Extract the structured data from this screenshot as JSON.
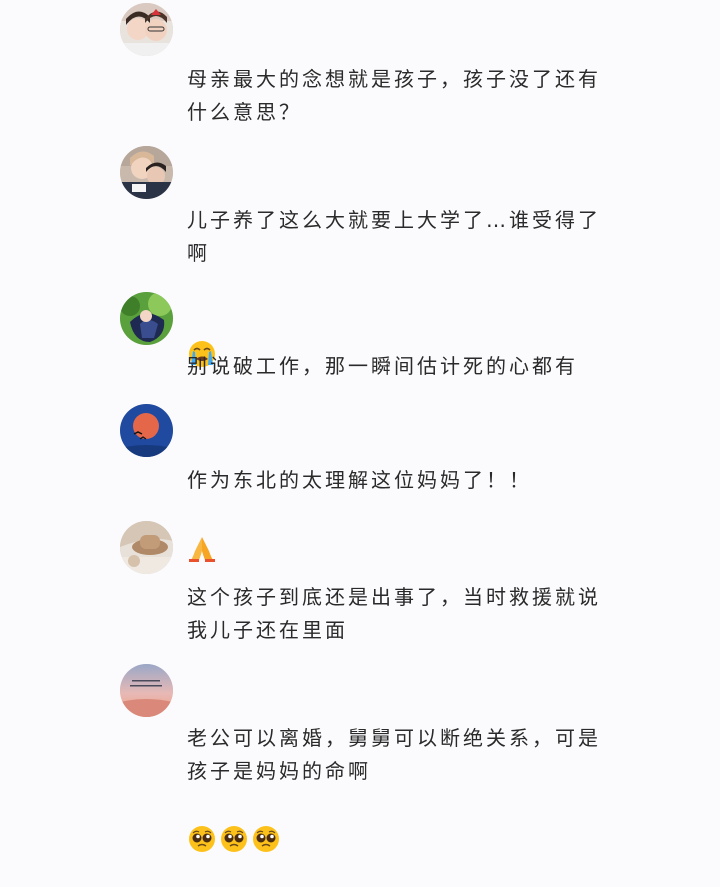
{
  "comments": [
    {
      "text": "母亲最大的念想就是孩子，孩子没了还有\n什么意思？",
      "avatar_icon": "avatar-two-girls-photo",
      "emojis": []
    },
    {
      "text": "儿子养了这么大就要上大学了…谁受得了啊",
      "avatar_icon": "avatar-two-people-photo",
      "emojis": [
        "crying-face-emoji"
      ]
    },
    {
      "text": "别说破工作，那一瞬间估计死的心都有",
      "avatar_icon": "avatar-plant-dark-photo",
      "emojis": []
    },
    {
      "text": "作为东北的太理解这位妈妈了！！",
      "avatar_icon": "avatar-red-moon-birds",
      "emojis": [
        "folded-hands-emoji"
      ]
    },
    {
      "text": "这个孩子到底还是出事了，当时救援就说\n我儿子还在里面",
      "avatar_icon": "avatar-beige-hat-photo",
      "emojis": []
    },
    {
      "text": "老公可以离婚，舅舅可以断绝关系，可是\n孩子是妈妈的命啊",
      "avatar_icon": "avatar-sunset-sky-text",
      "emojis": [
        "pleading-face-emoji",
        "pleading-face-emoji",
        "pleading-face-emoji"
      ]
    }
  ],
  "colors": {
    "background": "#fbfbfd",
    "text": "#2a2a2a",
    "emoji_yellow": "#fcc21b"
  }
}
